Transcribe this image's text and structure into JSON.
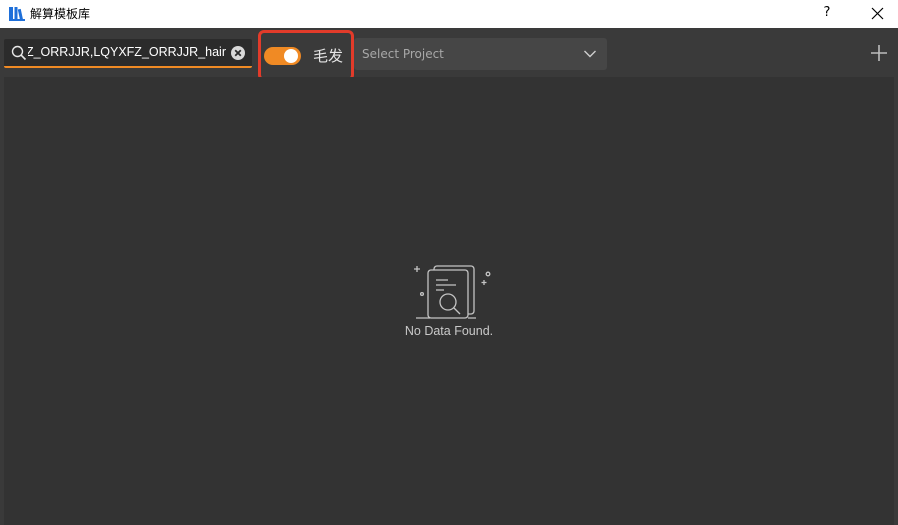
{
  "window": {
    "title": "解算模板库",
    "help_label": "?"
  },
  "toolbar": {
    "search": {
      "value": "LQYXFZ_ORRJJR,LQYXFZ_ORRJJR_hair",
      "placeholder": ""
    },
    "hair_toggle": {
      "label": "毛发",
      "on": true
    },
    "project_select": {
      "placeholder": "Select Project"
    }
  },
  "content": {
    "empty_message": "No Data Found."
  },
  "colors": {
    "accent": "#f08a24",
    "highlight_border": "#e23b2a",
    "toolbar_bg": "#3a3a3a",
    "content_bg": "#333333"
  },
  "icons": {
    "app": "library-books-icon",
    "search": "search-icon",
    "clear": "clear-circle-icon",
    "dropdown": "chevron-down-icon",
    "add": "plus-icon",
    "close": "close-icon",
    "empty": "no-data-document-search-icon"
  }
}
